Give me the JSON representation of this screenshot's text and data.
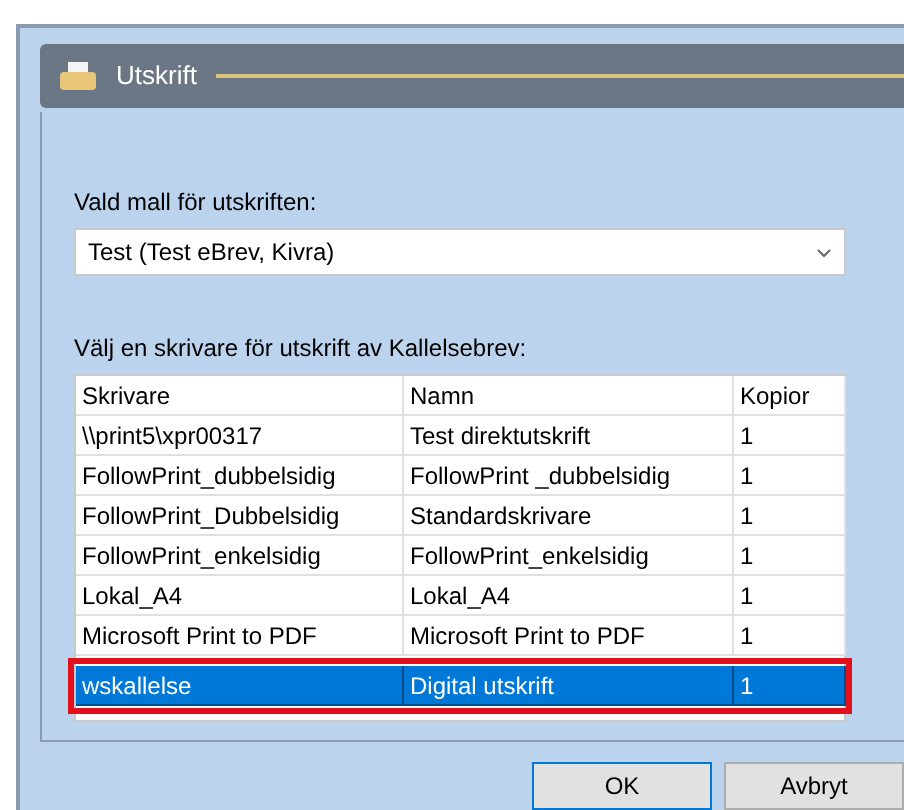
{
  "dialog": {
    "title": "Utskrift"
  },
  "template": {
    "label": "Vald mall för utskriften:",
    "value": "Test (Test eBrev, Kivra)"
  },
  "printers": {
    "label": "Välj en skrivare för utskrift av Kallelsebrev:",
    "columns": [
      "Skrivare",
      "Namn",
      "Kopior"
    ],
    "rows": [
      {
        "cells": [
          "\\\\print5\\xpr00317",
          "Test direktutskrift",
          "1"
        ],
        "selected": false
      },
      {
        "cells": [
          "FollowPrint_dubbelsidig",
          "FollowPrint _dubbelsidig",
          "1"
        ],
        "selected": false
      },
      {
        "cells": [
          "FollowPrint_Dubbelsidig",
          "Standardskrivare",
          "1"
        ],
        "selected": false
      },
      {
        "cells": [
          "FollowPrint_enkelsidig",
          "FollowPrint_enkelsidig",
          "1"
        ],
        "selected": false
      },
      {
        "cells": [
          "Lokal_A4",
          "Lokal_A4",
          "1"
        ],
        "selected": false
      },
      {
        "cells": [
          "Microsoft Print to PDF",
          "Microsoft Print to PDF",
          "1"
        ],
        "selected": false
      },
      {
        "cells": [
          "wskallelse",
          "Digital utskrift",
          "1"
        ],
        "selected": true
      }
    ]
  },
  "buttons": [
    "OK",
    "Avbryt"
  ]
}
